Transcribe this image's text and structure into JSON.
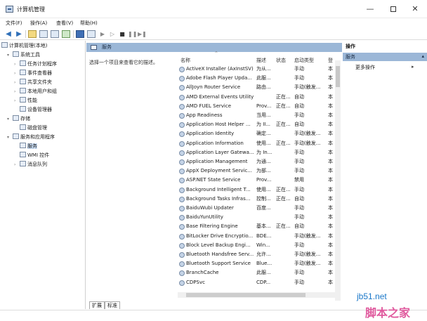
{
  "window": {
    "title": "计算机管理"
  },
  "menu": [
    "文件(F)",
    "操作(A)",
    "查看(V)",
    "帮助(H)"
  ],
  "tree": {
    "root": "计算机管理(本地)",
    "system_tools": "系统工具",
    "task_scheduler": "任务计划程序",
    "event_viewer": "事件查看器",
    "shared_folders": "共享文件夹",
    "local_users": "本地用户和组",
    "performance": "性能",
    "device_manager": "设备管理器",
    "storage": "存储",
    "disk_management": "磁盘管理",
    "services_apps": "服务和应用程序",
    "services": "服务",
    "wmi": "WMI 控件",
    "message_queue": "消息队列"
  },
  "center": {
    "header": "服务",
    "description": "选择一个项目来查看它的描述。",
    "columns": {
      "name": "名称",
      "desc": "描述",
      "status": "状态",
      "startup": "启动类型",
      "logon": "登"
    }
  },
  "services": [
    {
      "name": "ActiveX Installer (AxInstSV)",
      "desc": "为从...",
      "status": "",
      "startup": "手动",
      "logon": "本"
    },
    {
      "name": "Adobe Flash Player Upda...",
      "desc": "此服...",
      "status": "",
      "startup": "手动",
      "logon": "本"
    },
    {
      "name": "AllJoyn Router Service",
      "desc": "路由...",
      "status": "",
      "startup": "手动(触发...",
      "logon": "本"
    },
    {
      "name": "AMD External Events Utility",
      "desc": "",
      "status": "正在...",
      "startup": "自动",
      "logon": "本"
    },
    {
      "name": "AMD FUEL Service",
      "desc": "Prov...",
      "status": "正在...",
      "startup": "自动",
      "logon": "本"
    },
    {
      "name": "App Readiness",
      "desc": "当用...",
      "status": "",
      "startup": "手动",
      "logon": "本"
    },
    {
      "name": "Application Host Helper ...",
      "desc": "为 II...",
      "status": "正在...",
      "startup": "自动",
      "logon": "本"
    },
    {
      "name": "Application Identity",
      "desc": "确定...",
      "status": "",
      "startup": "手动(触发...",
      "logon": "本"
    },
    {
      "name": "Application Information",
      "desc": "使用...",
      "status": "正在...",
      "startup": "手动(触发...",
      "logon": "本"
    },
    {
      "name": "Application Layer Gatewa...",
      "desc": "为 In...",
      "status": "",
      "startup": "手动",
      "logon": "本"
    },
    {
      "name": "Application Management",
      "desc": "为通...",
      "status": "",
      "startup": "手动",
      "logon": "本"
    },
    {
      "name": "AppX Deployment Servic...",
      "desc": "为部...",
      "status": "",
      "startup": "手动",
      "logon": "本"
    },
    {
      "name": "ASP.NET State Service",
      "desc": "Prov...",
      "status": "",
      "startup": "禁用",
      "logon": "本"
    },
    {
      "name": "Background Intelligent T...",
      "desc": "使用...",
      "status": "正在...",
      "startup": "手动",
      "logon": "本"
    },
    {
      "name": "Background Tasks Infras...",
      "desc": "控制...",
      "status": "正在...",
      "startup": "自动",
      "logon": "本"
    },
    {
      "name": "BaiduWubi Updater",
      "desc": "百度...",
      "status": "",
      "startup": "手动",
      "logon": "本"
    },
    {
      "name": "BaiduYunUtility",
      "desc": "",
      "status": "",
      "startup": "手动",
      "logon": "本"
    },
    {
      "name": "Base Filtering Engine",
      "desc": "基本...",
      "status": "正在...",
      "startup": "自动",
      "logon": "本"
    },
    {
      "name": "BitLocker Drive Encryptio...",
      "desc": "BDE...",
      "status": "",
      "startup": "手动(触发...",
      "logon": "本"
    },
    {
      "name": "Block Level Backup Engi...",
      "desc": "Win...",
      "status": "",
      "startup": "手动",
      "logon": "本"
    },
    {
      "name": "Bluetooth Handsfree Serv...",
      "desc": "允许...",
      "status": "",
      "startup": "手动(触发...",
      "logon": "本"
    },
    {
      "name": "Bluetooth Support Service",
      "desc": "Blue...",
      "status": "",
      "startup": "手动(触发...",
      "logon": "本"
    },
    {
      "name": "BranchCache",
      "desc": "此服...",
      "status": "",
      "startup": "手动",
      "logon": "本"
    },
    {
      "name": "CDPSvc",
      "desc": "CDP...",
      "status": "",
      "startup": "手动",
      "logon": "本"
    }
  ],
  "tabs": [
    "扩展",
    "标准"
  ],
  "actions": {
    "title": "操作",
    "section": "服务",
    "more": "更多操作"
  },
  "watermark": {
    "line1": "jb51.net",
    "line2": "脚本之家"
  }
}
